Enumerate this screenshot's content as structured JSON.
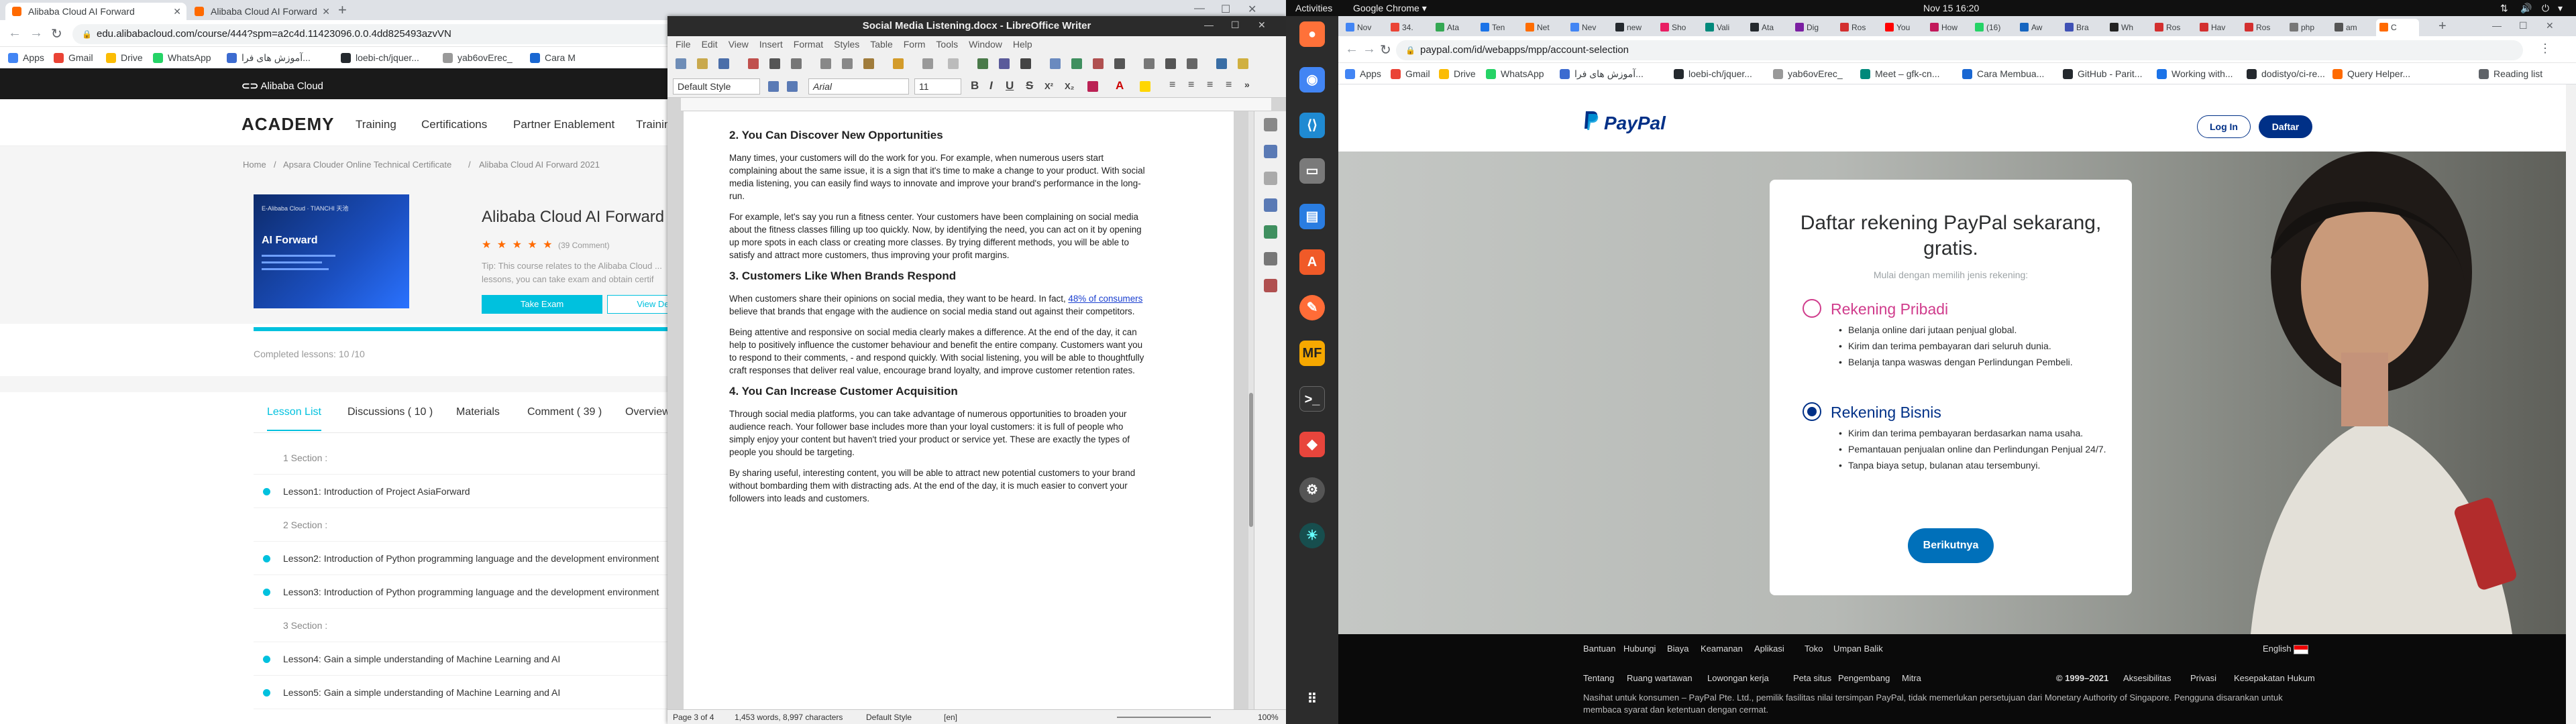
{
  "left_browser": {
    "tabs": [
      {
        "title": "Alibaba Cloud AI Forward",
        "active": true
      },
      {
        "title": "Alibaba Cloud AI Forward",
        "active": false
      }
    ],
    "url": "edu.alibabacloud.com/course/444?spm=a2c4d.11423096.0.0.4dd825493azvVN",
    "bookmarks": [
      "Apps",
      "Gmail",
      "Drive",
      "WhatsApp",
      "آموزش های فرا...",
      "loebi-ch/jquer...",
      "yab6ovErec_",
      "Cara M"
    ],
    "site_logo": "Alibaba Cloud",
    "academy": "ACADEMY",
    "nav": [
      "Training",
      "Certifications",
      "Partner Enablement",
      "Trainin"
    ],
    "breadcrumb": [
      "Home",
      "/",
      "Apsara Clouder Online Technical Certificate",
      "/",
      "Alibaba Cloud AI Forward 2021"
    ],
    "course_image_heading": "AI Forward",
    "course_image_tag": "E-Alibaba Cloud · TIANCHI 天池",
    "course_title": "Alibaba Cloud AI Forward 20",
    "stars": "★ ★ ★ ★ ★",
    "comments": "(39 Comment)",
    "tip": "Tip: This course relates to the Alibaba Cloud ... lessons, you can take exam and obtain certif",
    "take_exam": "Take Exam",
    "view_details": "View Details",
    "progress": 1.0,
    "completed_lessons": "Completed lessons: 10 /10",
    "course_tabs": [
      "Lesson List",
      "Discussions ( 10 )",
      "Materials",
      "Comment ( 39 )",
      "Overview"
    ],
    "lessons": [
      {
        "kind": "section",
        "text": "1 Section :"
      },
      {
        "kind": "lesson",
        "text": "Lesson1:   Introduction of Project AsiaForward"
      },
      {
        "kind": "section",
        "text": "2 Section :"
      },
      {
        "kind": "lesson",
        "text": "Lesson2:   Introduction of Python programming language and the development environment"
      },
      {
        "kind": "lesson",
        "text": "Lesson3:   Introduction of Python programming language and the development environment"
      },
      {
        "kind": "section",
        "text": "3 Section :"
      },
      {
        "kind": "lesson",
        "text": "Lesson4:   Gain a simple understanding of Machine Learning and AI"
      },
      {
        "kind": "lesson",
        "text": "Lesson5:   Gain a simple understanding of Machine Learning and AI"
      }
    ]
  },
  "writer": {
    "title": "Social Media Listening.docx - LibreOffice Writer",
    "menu": [
      "File",
      "Edit",
      "View",
      "Insert",
      "Format",
      "Styles",
      "Table",
      "Form",
      "Tools",
      "Window",
      "Help"
    ],
    "para_style": "Default Style",
    "font_name": "Arial",
    "font_size": "11",
    "doc": {
      "h2": "2. You Can Discover New Opportunities",
      "p2a": "Many times, your customers will do the work for you. For example, when numerous users start complaining about the same issue, it is a sign that it's time to make a change to your product. With social media listening, you can easily find ways to innovate and improve your brand's performance in the long-run.",
      "p2b": "For example, let's say you run a fitness center. Your customers have been complaining on social media about the fitness classes filling up too quickly. Now, by identifying the need, you can act on it by opening up more spots in each class or creating more classes. By trying different methods, you will be able to satisfy and attract more customers, thus improving your profit margins.",
      "h3": "3. Customers Like When Brands Respond",
      "p3a_pre": "When customers share their opinions on social media, they want to be heard. In fact, ",
      "p3a_link": "48% of consumers",
      "p3a_post": " believe that brands that engage with the audience on social media stand out against their competitors.",
      "p3b": "Being attentive and responsive on social media clearly makes a difference. At the end of the day, it can help to positively influence the customer behaviour and benefit the entire company. Customers want you to respond to their comments, - and respond quickly. With social listening, you will be able to thoughtfully craft responses that deliver real value, encourage brand loyalty, and improve customer retention rates.",
      "h4": "4. You Can Increase Customer Acquisition",
      "p4a": "Through social media platforms, you can take advantage of numerous opportunities to broaden your audience reach. Your follower base includes more than your loyal customers: it is full of people who simply enjoy your content but haven't tried your product or service yet. These are exactly the types of people you should be targeting.",
      "p4b": "By sharing useful, interesting content, you will be able to attract new potential customers to your brand without bombarding them with distracting ads. At the end of the day, it is much easier to convert your followers into leads and customers."
    },
    "status": {
      "page": "Page 3 of 4",
      "words": "1,453 words, 8,997 characters",
      "style": "Default Style",
      "lang": "[en]",
      "zoom": "100%"
    }
  },
  "system": {
    "activities": "Activities",
    "app": "Google Chrome ▾",
    "clock": "Nov 15  16:20",
    "dock_apps": [
      "Firefox",
      "Chrome",
      "VS Code",
      "Files",
      "Docs",
      "Software",
      "Postman",
      "MF",
      "Terminal",
      "AnyDesk",
      "Settings",
      "Bulb",
      "Show Apps"
    ]
  },
  "right_browser": {
    "tab_labels": [
      "Nov",
      "34.",
      "Ata",
      "Ten",
      "Net",
      "Nev",
      "new",
      "Sho",
      "Vali",
      "Ata",
      "Dig",
      "Ros",
      "You",
      "How",
      "(16)",
      "Aw",
      "Bra",
      "Wh",
      "Ros",
      "Hav",
      "Ros",
      "php",
      "am",
      "C"
    ],
    "url": "paypal.com/id/webapps/mpp/account-selection",
    "bookmarks": [
      "Apps",
      "Gmail",
      "Drive",
      "WhatsApp",
      "آموزش های فرا...",
      "loebi-ch/jquer...",
      "yab6ovErec_",
      "Meet – gfk-cn...",
      "Cara Membua...",
      "GitHub - Parit...",
      "Working with...",
      "dodistyo/ci-re...",
      "Query Helper...",
      "Reading list"
    ],
    "paypal_logo": "PayPal",
    "login": "Log In",
    "signup": "Daftar",
    "card_title": "Daftar rekening PayPal sekarang, gratis.",
    "card_sub": "Mulai dengan memilih jenis rekening:",
    "personal": {
      "title": "Rekening Pribadi",
      "items": [
        "Belanja online dari jutaan penjual global.",
        "Kirim dan terima pembayaran dari seluruh dunia.",
        "Belanja tanpa waswas dengan Perlindungan Pembeli."
      ]
    },
    "business": {
      "title": "Rekening Bisnis",
      "items": [
        "Kirim dan terima pembayaran berdasarkan nama usaha.",
        "Pemantauan penjualan online dan Perlindungan Penjual 24/7.",
        "Tanpa biaya setup, bulanan atau tersembunyi."
      ]
    },
    "next": "Berikutnya",
    "footer_row1": [
      "Bantuan",
      "Hubungi",
      "Biaya",
      "Keamanan",
      "Aplikasi",
      "Toko",
      "Umpan Balik"
    ],
    "language": "English",
    "footer_row2": [
      "Tentang",
      "Ruang wartawan",
      "Lowongan kerja",
      "Peta situs",
      "Pengembang",
      "Mitra"
    ],
    "copyright": "© 1999–2021",
    "footer_legal": [
      "Aksesibilitas",
      "Privasi",
      "Kesepakatan Hukum"
    ],
    "notice": "Nasihat untuk konsumen – PayPal Pte. Ltd., pemilik fasilitas nilai tersimpan PayPal, tidak memerlukan persetujuan dari Monetary Authority of Singapore. Pengguna disarankan untuk membaca syarat dan ketentuan dengan cermat."
  },
  "colors": {
    "alibaba_orange": "#ff6a00",
    "alibaba_cyan": "#00c1de",
    "paypal_navy": "#003087",
    "paypal_blue": "#0070ba",
    "paypal_pink": "#d03c8c"
  }
}
